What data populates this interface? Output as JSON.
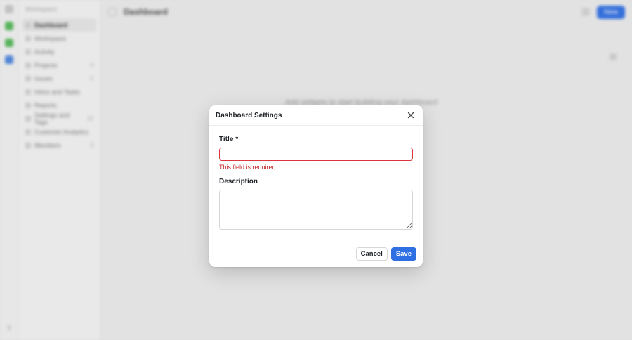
{
  "background": {
    "sidebar": {
      "workspace": "Workspace",
      "items": [
        {
          "label": "Dashboard",
          "count": ""
        },
        {
          "label": "Workspace",
          "count": ""
        },
        {
          "label": "Activity",
          "count": ""
        },
        {
          "label": "Projects",
          "count": "4"
        },
        {
          "label": "Issues",
          "count": "2"
        },
        {
          "label": "Inbox and Tasks",
          "count": ""
        },
        {
          "label": "Reports",
          "count": ""
        },
        {
          "label": "Settings and Tags",
          "count": "12"
        },
        {
          "label": "Customer Analytics",
          "count": ""
        },
        {
          "label": "Members",
          "count": "3"
        }
      ],
      "rail_bottom": "?"
    },
    "topbar": {
      "title": "Dashboard",
      "action_button": "New"
    },
    "empty_text": "Add widgets to start building your dashboard"
  },
  "modal": {
    "title": "Dashboard Settings",
    "title_label": "Title",
    "required_marker": "*",
    "title_value": "",
    "error": "This field is required",
    "description_label": "Description",
    "description_value": "",
    "cancel": "Cancel",
    "save": "Save"
  },
  "colors": {
    "primary": "#2f6fe4",
    "error": "#d9363e"
  }
}
